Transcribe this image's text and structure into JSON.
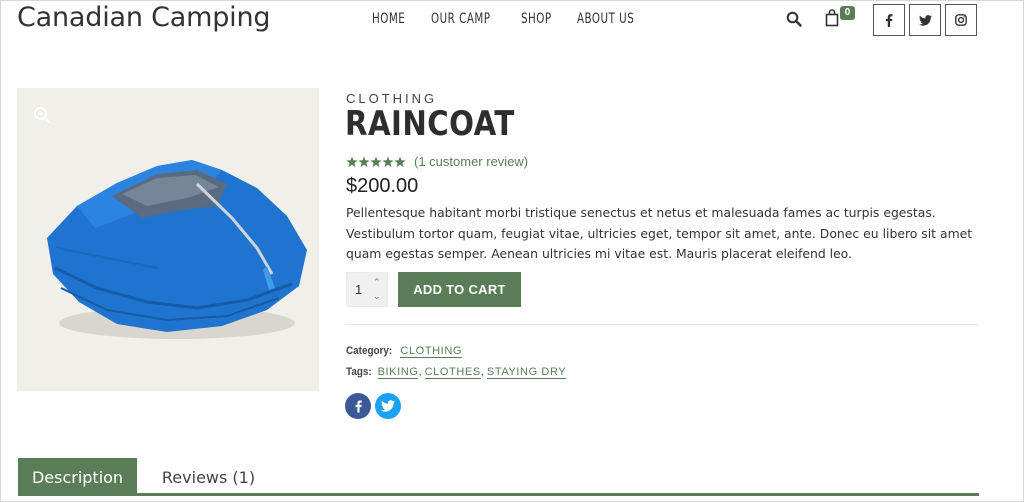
{
  "site": {
    "title": "Canadian Camping"
  },
  "nav": {
    "items": [
      {
        "label": "HOME"
      },
      {
        "label": "OUR CAMP"
      },
      {
        "label": "SHOP"
      },
      {
        "label": "ABOUT US"
      }
    ]
  },
  "header": {
    "search_icon": "search-icon",
    "cart_icon": "shopping-bag-icon",
    "cart_count": "0",
    "social": [
      {
        "name": "facebook-icon"
      },
      {
        "name": "twitter-icon"
      },
      {
        "name": "instagram-icon"
      }
    ]
  },
  "product": {
    "category": "CLOTHING",
    "title": "RAINCOAT",
    "rating": 5,
    "review_link": "(1 customer review)",
    "price": "$200.00",
    "description": "Pellentesque habitant morbi tristique senectus et netus et malesuada fames ac turpis egestas. Vestibulum tortor quam, feugiat vitae, ultricies eget, tempor sit amet, ante. Donec eu libero sit amet quam egestas semper. Aenean ultricies mi vitae est. Mauris placerat eleifend leo.",
    "quantity": "1",
    "add_to_cart_label": "ADD TO CART",
    "meta": {
      "category_label": "Category:",
      "category_value": "CLOTHING",
      "tags_label": "Tags:",
      "tags": [
        "BIKING",
        "CLOTHES",
        "STAYING DRY"
      ],
      "sep": ","
    }
  },
  "tabs": [
    {
      "label": "Description",
      "active": true
    },
    {
      "label": "Reviews (1)",
      "active": false
    }
  ],
  "colors": {
    "accent": "#5a7d57",
    "facebook": "#3b5998",
    "twitter": "#1da1f2",
    "jacket": "#1f74cf"
  }
}
